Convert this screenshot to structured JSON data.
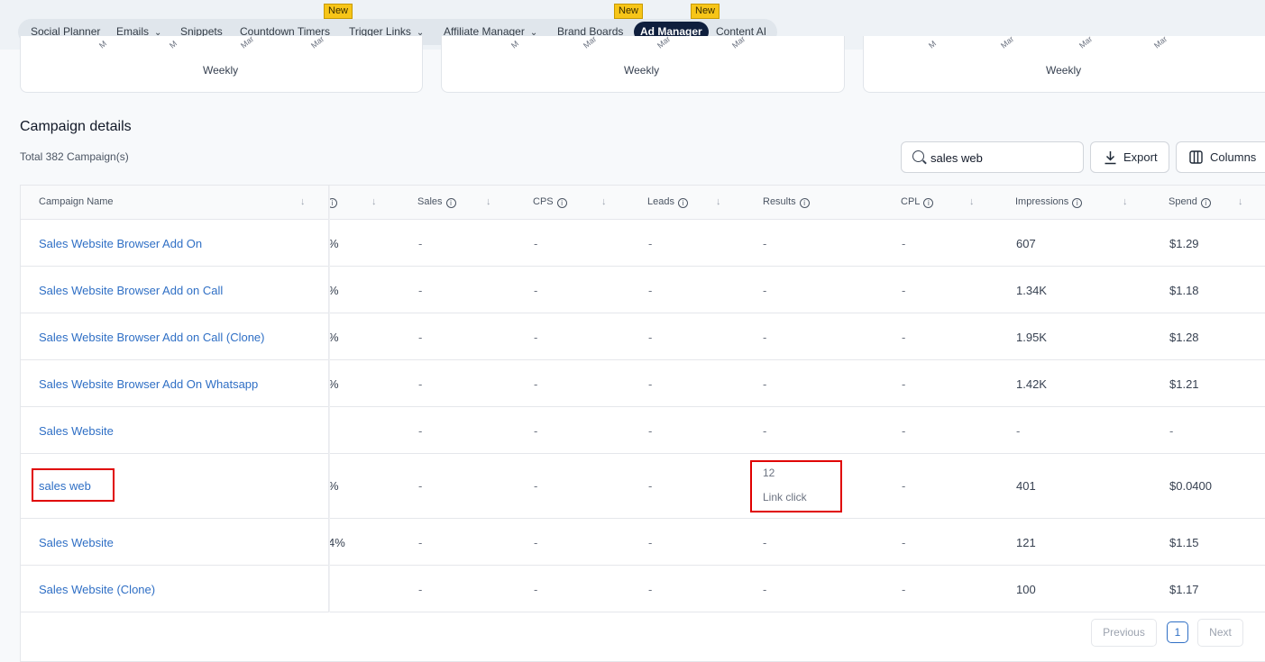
{
  "nav": {
    "items": [
      {
        "label": "Social Planner"
      },
      {
        "label": "Emails"
      },
      {
        "label": "Snippets"
      },
      {
        "label": "Countdown Timers"
      },
      {
        "label": "Trigger Links"
      },
      {
        "label": "Affiliate Manager"
      },
      {
        "label": "Brand Boards"
      },
      {
        "label": "Ad Manager"
      },
      {
        "label": "Content AI"
      }
    ],
    "new_badge": "New",
    "active": "Ad Manager"
  },
  "charts": {
    "weekly_label": "Weekly",
    "tick_prefix_a": "M",
    "tick_prefix_b": "Mar"
  },
  "campaigns": {
    "title": "Campaign details",
    "total": "Total 382 Campaign(s)",
    "search_value": "sales web",
    "export_label": "Export",
    "columns_label": "Columns",
    "headers": {
      "name": "Campaign Name",
      "sales": "Sales",
      "cps": "CPS",
      "leads": "Leads",
      "results": "Results",
      "cpl": "CPL",
      "impressions": "Impressions",
      "spend": "Spend"
    },
    "rows": [
      {
        "name": "Sales Website Browser Add On",
        "pct": "%",
        "sales": "-",
        "cps": "-",
        "leads": "-",
        "results": "-",
        "cpl": "-",
        "impressions": "607",
        "spend": "$1.29"
      },
      {
        "name": "Sales Website Browser Add on Call",
        "pct": "%",
        "sales": "-",
        "cps": "-",
        "leads": "-",
        "results": "-",
        "cpl": "-",
        "impressions": "1.34K",
        "spend": "$1.18"
      },
      {
        "name": "Sales Website Browser Add on Call (Clone)",
        "pct": "%",
        "sales": "-",
        "cps": "-",
        "leads": "-",
        "results": "-",
        "cpl": "-",
        "impressions": "1.95K",
        "spend": "$1.28"
      },
      {
        "name": "Sales Website Browser Add On Whatsapp",
        "pct": "%",
        "sales": "-",
        "cps": "-",
        "leads": "-",
        "results": "-",
        "cpl": "-",
        "impressions": "1.42K",
        "spend": "$1.21"
      },
      {
        "name": "Sales Website",
        "pct": "",
        "sales": "-",
        "cps": "-",
        "leads": "-",
        "results": "-",
        "cpl": "-",
        "impressions": "-",
        "spend": "-"
      },
      {
        "name": "sales web",
        "pct": "%",
        "sales": "-",
        "cps": "-",
        "leads": "-",
        "results": "12",
        "results_sub": "Link click",
        "cpl": "-",
        "impressions": "401",
        "spend": "$0.0400"
      },
      {
        "name": "Sales Website",
        "pct": "4%",
        "sales": "-",
        "cps": "-",
        "leads": "-",
        "results": "-",
        "cpl": "-",
        "impressions": "121",
        "spend": "$1.15"
      },
      {
        "name": "Sales Website (Clone)",
        "pct": "",
        "sales": "-",
        "cps": "-",
        "leads": "-",
        "results": "-",
        "cpl": "-",
        "impressions": "100",
        "spend": "$1.17"
      }
    ],
    "pagination": {
      "previous": "Previous",
      "current": "1",
      "next": "Next"
    }
  }
}
